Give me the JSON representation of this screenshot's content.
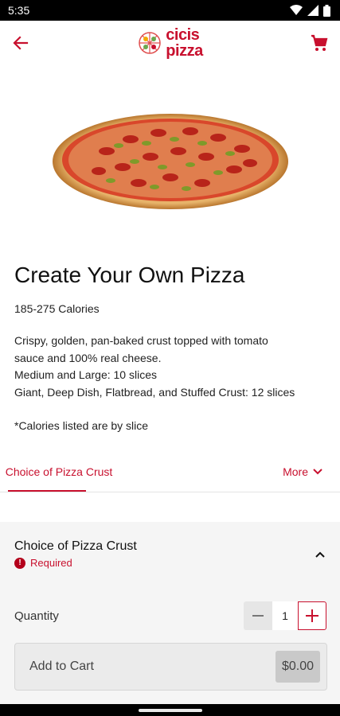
{
  "status_bar": {
    "time": "5:35"
  },
  "header": {
    "logo_line1": "cicis",
    "logo_line2": "pizza",
    "accent_color": "#c8102e"
  },
  "product": {
    "title": "Create Your Own Pizza",
    "calories": "185-275 Calories",
    "description_lines": [
      "Crispy, golden, pan-baked crust topped with tomato",
      "sauce and 100% real cheese.",
      "Medium and Large: 10 slices",
      "Giant, Deep Dish, Flatbread, and Stuffed Crust: 12 slices"
    ],
    "note": "*Calories listed are by slice"
  },
  "tabs": {
    "active": "Choice of Pizza Crust",
    "more": "More"
  },
  "section": {
    "title": "Choice of Pizza Crust",
    "required": "Required"
  },
  "order": {
    "quantity_label": "Quantity",
    "quantity": "1",
    "add_to_cart": "Add to Cart",
    "price": "$0.00"
  }
}
